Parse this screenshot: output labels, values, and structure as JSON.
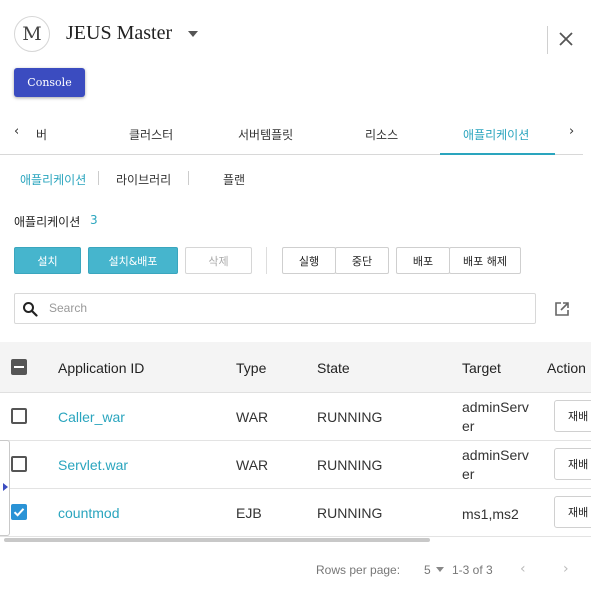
{
  "header": {
    "avatar_letter": "M",
    "server_name": "JEUS Master",
    "console_label": "Console"
  },
  "tabs": {
    "items": [
      {
        "label": "버"
      },
      {
        "label": "클러스터"
      },
      {
        "label": "서버템플릿"
      },
      {
        "label": "리소스"
      },
      {
        "label": "애플리케이션"
      }
    ],
    "active": "애플리케이션",
    "prev_glyph": "‹",
    "next_glyph": "›"
  },
  "subtabs": {
    "items": [
      {
        "label": "애플리케이션"
      },
      {
        "label": "라이브러리"
      },
      {
        "label": "플랜"
      }
    ],
    "active": "애플리케이션"
  },
  "section": {
    "title": "애플리케이션",
    "count": "3"
  },
  "toolbar": {
    "install": "설치",
    "install_deploy": "설치&배포",
    "delete": "삭제",
    "run": "실행",
    "stop": "중단",
    "deploy": "배포",
    "undeploy": "배포 해제"
  },
  "search": {
    "placeholder": "Search"
  },
  "table": {
    "headers": [
      "Application ID",
      "Type",
      "State",
      "Target",
      "Action"
    ],
    "rows": [
      {
        "id": "Caller_war",
        "type": "WAR",
        "state": "RUNNING",
        "target": "adminServer",
        "action": "재배",
        "checked": false
      },
      {
        "id": "Servlet.war",
        "type": "WAR",
        "state": "RUNNING",
        "target": "adminServer",
        "action": "재배",
        "checked": false
      },
      {
        "id": "countmod",
        "type": "EJB",
        "state": "RUNNING",
        "target": "ms1,ms2",
        "action": "재배",
        "checked": true
      }
    ]
  },
  "pagination": {
    "rows_per_page_label": "Rows per page:",
    "rows_per_page": "5",
    "range": "1-3 of 3",
    "prev_glyph": "‹",
    "next_glyph": "›"
  },
  "colors": {
    "accent": "#2aa5be",
    "primary_button": "#46b5cd",
    "console_button": "#3b4cc0",
    "checkbox_checked": "#2a93d6"
  }
}
